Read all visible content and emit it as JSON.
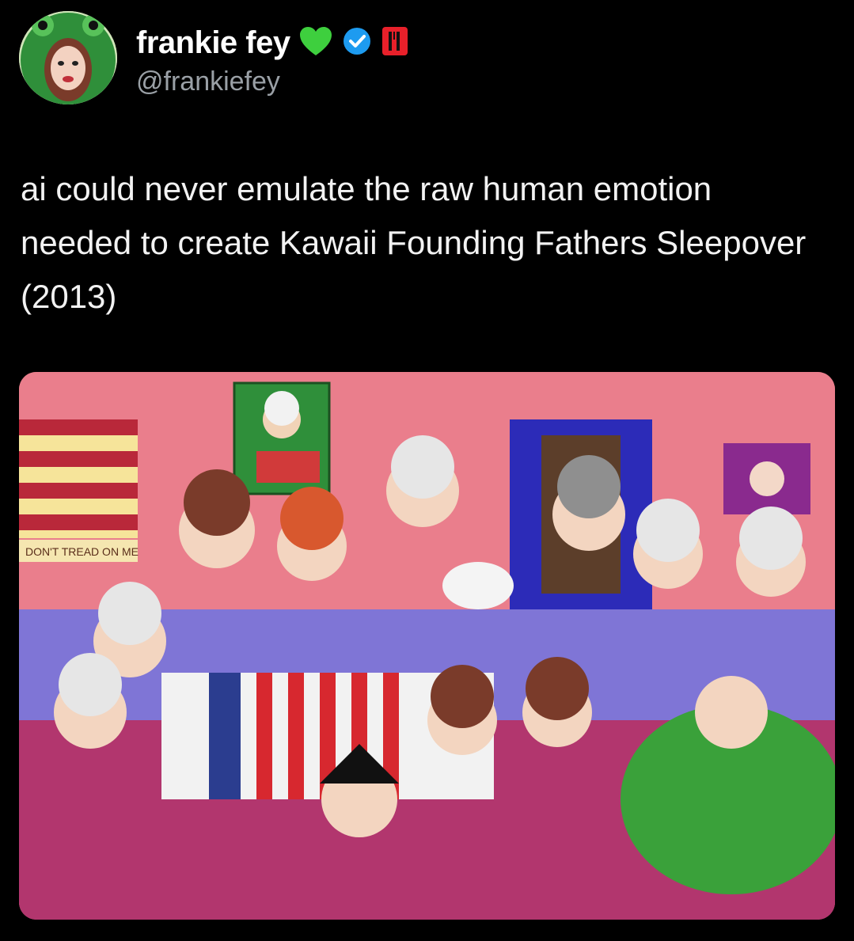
{
  "author": {
    "display_name": "frankie fey",
    "handle": "@frankiefey",
    "heart_badge_color": "#3ecf3e",
    "verified_badge_color": "#1d9bf0",
    "flag_badge_color": "#e8202a"
  },
  "tweet": {
    "text": "ai could never emulate the raw human emotion needed to create Kawaii Founding Fathers Sleepover (2013)"
  },
  "media": {
    "banner_text": "DON'T TREAD ON ME",
    "icons": [
      "heart-icon",
      "verified-icon",
      "flag-icon"
    ]
  }
}
